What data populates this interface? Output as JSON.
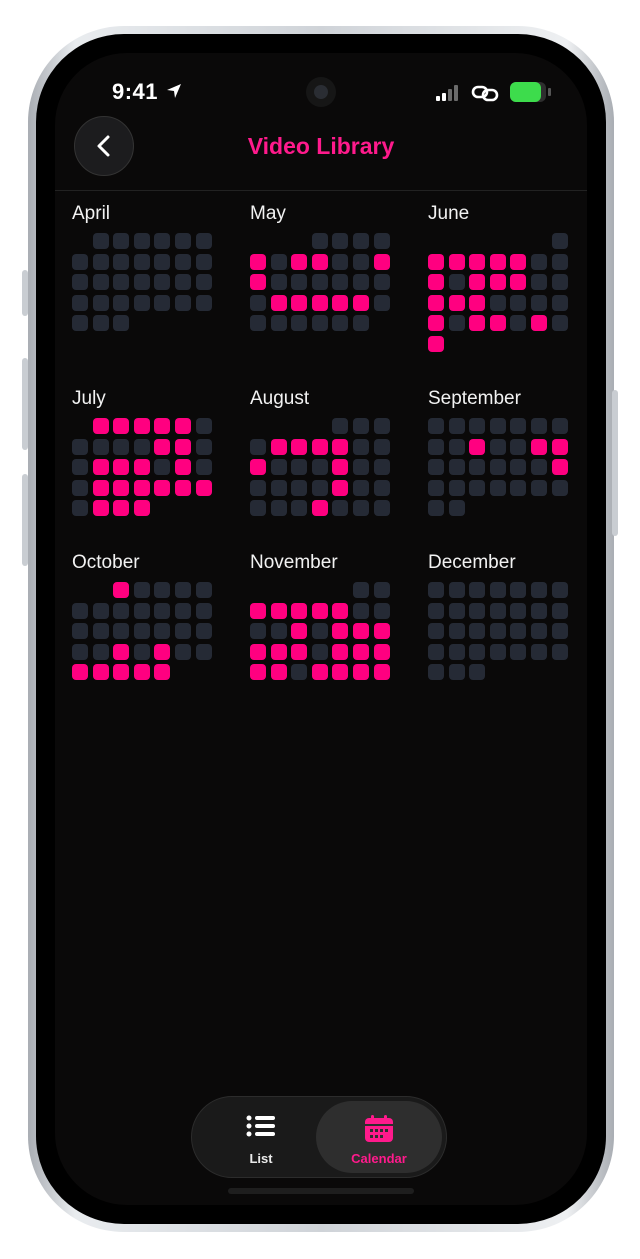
{
  "status_bar": {
    "time": "9:41",
    "battery_level": 0.85
  },
  "header": {
    "title": "Video Library"
  },
  "months": [
    {
      "name": "April",
      "offset": 1,
      "days": 30,
      "recorded": []
    },
    {
      "name": "May",
      "offset": 3,
      "days": 31,
      "recorded": [
        5,
        7,
        8,
        11,
        12,
        20,
        21,
        22,
        23,
        24
      ]
    },
    {
      "name": "June",
      "offset": 6,
      "days": 30,
      "recorded": [
        2,
        3,
        4,
        5,
        6,
        9,
        11,
        12,
        13,
        16,
        17,
        18,
        23,
        25,
        26,
        28,
        30
      ]
    },
    {
      "name": "July",
      "offset": 1,
      "days": 31,
      "recorded": [
        1,
        2,
        3,
        4,
        5,
        11,
        12,
        15,
        16,
        17,
        19,
        22,
        23,
        24,
        25,
        26,
        27,
        29,
        30,
        31
      ]
    },
    {
      "name": "August",
      "offset": 4,
      "days": 31,
      "recorded": [
        5,
        6,
        7,
        8,
        11,
        15,
        22,
        28
      ]
    },
    {
      "name": "September",
      "offset": 0,
      "days": 30,
      "recorded": [
        10,
        13,
        14,
        21
      ]
    },
    {
      "name": "October",
      "offset": 2,
      "days": 31,
      "recorded": [
        1,
        22,
        24,
        27,
        28,
        29,
        30,
        31
      ]
    },
    {
      "name": "November",
      "offset": 5,
      "days": 30,
      "recorded": [
        3,
        4,
        5,
        6,
        7,
        12,
        14,
        15,
        16,
        17,
        18,
        19,
        21,
        22,
        23,
        24,
        25,
        27,
        28,
        29,
        30
      ]
    },
    {
      "name": "December",
      "offset": 0,
      "days": 31,
      "recorded": []
    }
  ],
  "tabs": {
    "list_label": "List",
    "calendar_label": "Calendar",
    "selected": "Calendar"
  },
  "colors": {
    "accent": "#ff0080",
    "inactive_day": "#252a35",
    "background": "#0a0909"
  },
  "icons": [
    "location-arrow-icon",
    "signal-icon",
    "link-icon",
    "battery-icon",
    "chevron-left-icon",
    "list-icon",
    "calendar-icon"
  ]
}
